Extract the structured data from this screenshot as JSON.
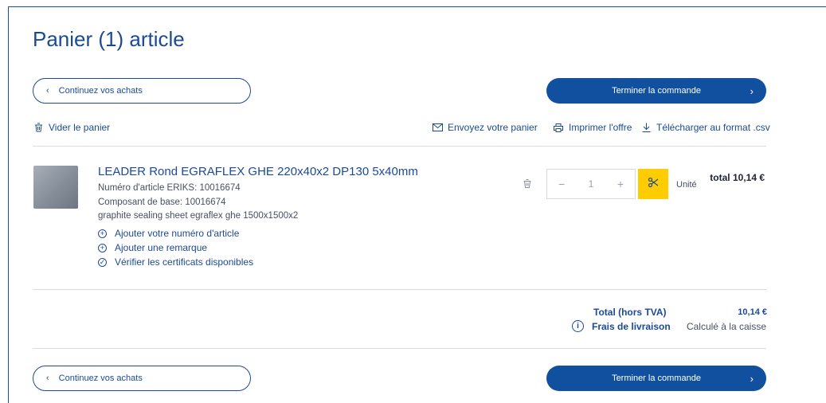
{
  "page": {
    "title": "Panier (1) article"
  },
  "nav": {
    "continue_label": "Continuez vos achats",
    "finish_label": "Terminer la commande",
    "chev_left": "‹",
    "chev_right": "›"
  },
  "toolbar": {
    "empty_cart": "Vider le panier",
    "send_cart": "Envoyez votre panier",
    "print_offer": "Imprimer l'offre",
    "download_csv": "Télécharger au format .csv"
  },
  "item": {
    "name": "LEADER Rond EGRAFLEX GHE 220x40x2 DP130 5x40mm",
    "article_number": "Numéro d'article ERIKS: 10016674",
    "base_component": "Composant de base: 10016674",
    "description": "graphite sealing sheet egraflex ghe 1500x1500x2",
    "actions": [
      {
        "icon": "plus-circle-icon",
        "symbol": "+",
        "label": "Ajouter votre numéro d'article"
      },
      {
        "icon": "plus-circle-icon",
        "symbol": "+",
        "label": "Ajouter une remarque"
      },
      {
        "icon": "check-circle-icon",
        "symbol": "✓",
        "label": "Vérifier les certificats disponibles"
      }
    ],
    "quantity": "1",
    "minus": "−",
    "plus": "+",
    "unit": "Unité",
    "total": "total 10,14 €"
  },
  "summary": {
    "total_label": "Total (hors TVA)",
    "total_value": "10,14 €",
    "shipping_label": "Frais de livraison",
    "shipping_value": "Calculé à la caisse"
  },
  "colors": {
    "brand_blue": "#10509f",
    "accent_yellow": "#ffcc00"
  }
}
